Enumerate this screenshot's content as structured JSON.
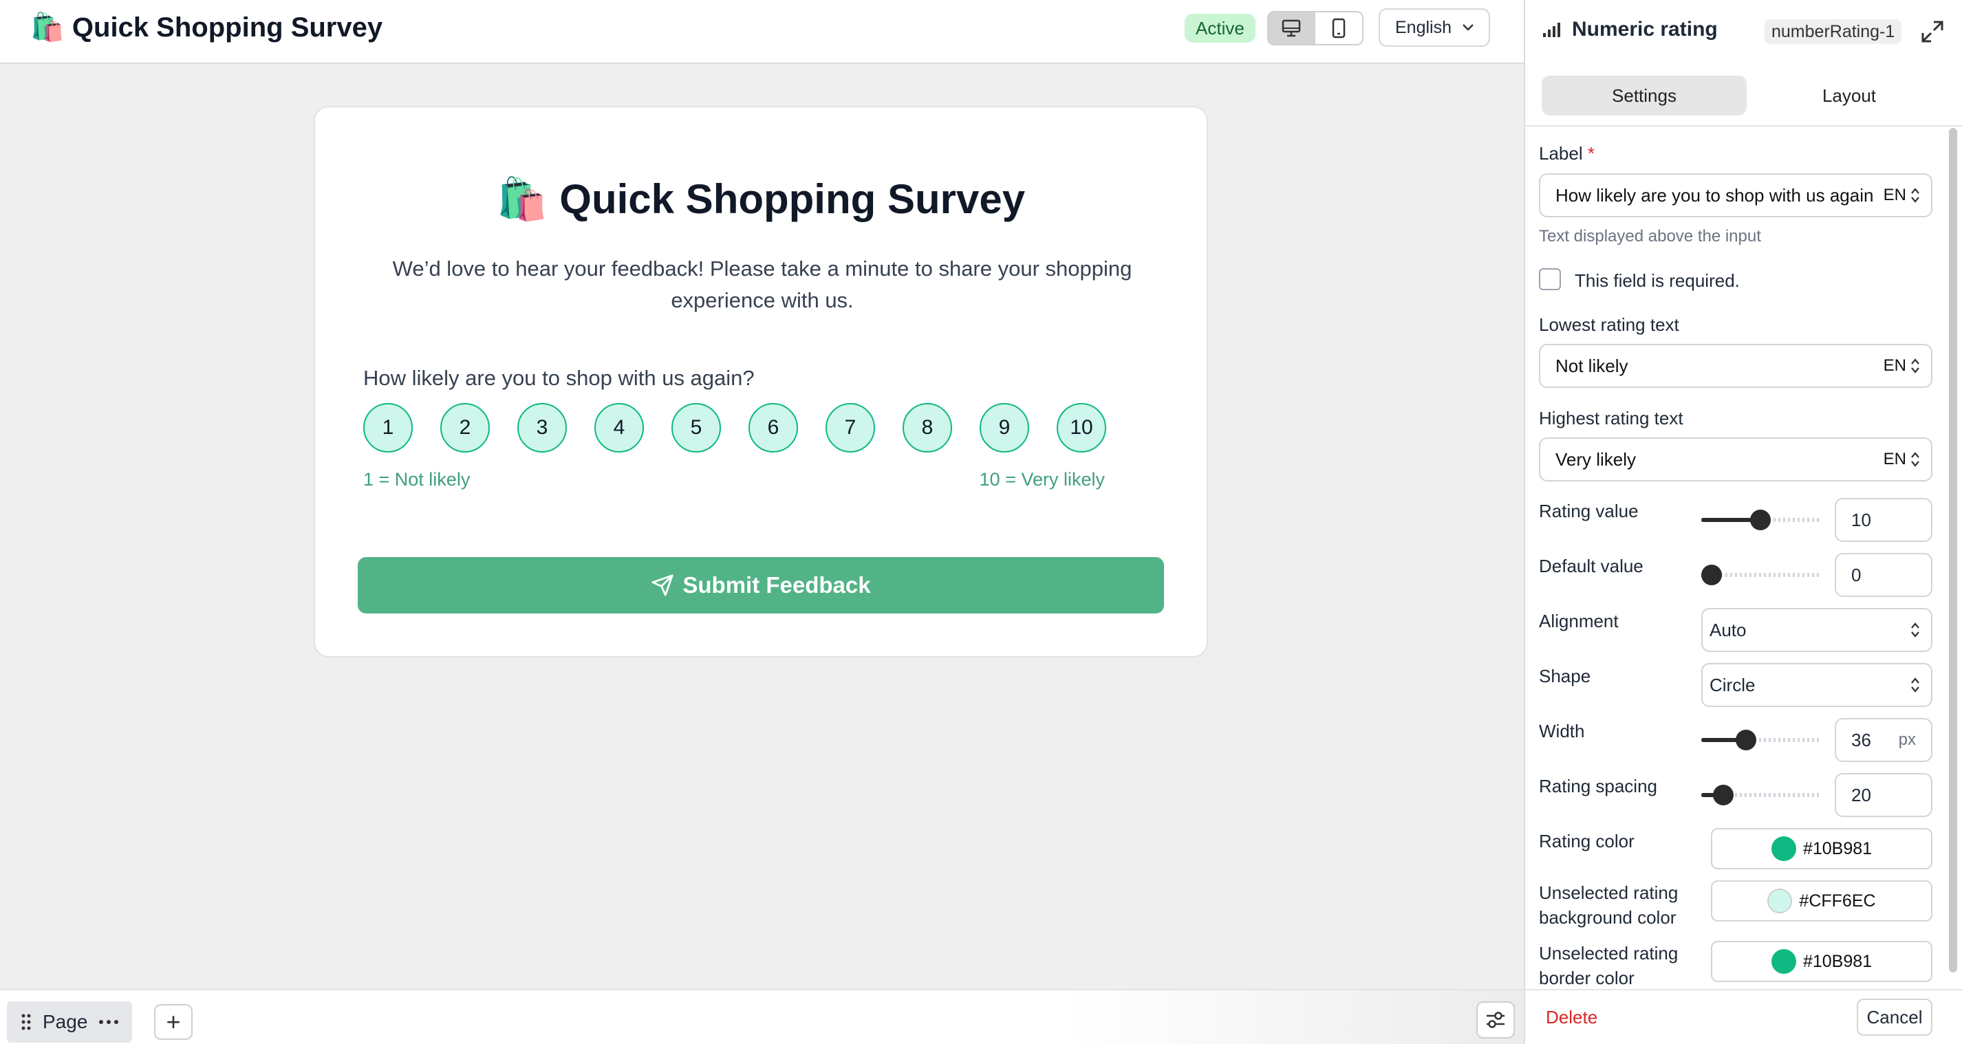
{
  "app": {
    "title": "🛍️ Quick Shopping Survey",
    "status": "Active",
    "language": "English",
    "device_icons": [
      "desktop-icon",
      "mobile-icon"
    ]
  },
  "survey": {
    "title": "🛍️ Quick Shopping Survey",
    "description": "We’d love to hear your feedback! Please take a minute to share your shopping experience with us.",
    "question": "How likely are you to shop with us again?",
    "ratings": [
      "1",
      "2",
      "3",
      "4",
      "5",
      "6",
      "7",
      "8",
      "9",
      "10"
    ],
    "low_text": "1 = Not likely",
    "high_text": "10 = Very likely",
    "submit_label": "Submit Feedback"
  },
  "bottom": {
    "page_label": "Page",
    "add_label": "+"
  },
  "panel": {
    "title": "Numeric rating",
    "element_id": "numberRating-1",
    "tabs": [
      "Settings",
      "Layout"
    ],
    "active_tab": "Settings",
    "label_label": "Label",
    "required_star": "*",
    "label_value": "How likely are you to shop with us again?",
    "lang_code": "EN",
    "label_help": "Text displayed above the input",
    "required_text": "This field is required.",
    "required_checked": false,
    "lowest_label": "Lowest rating text",
    "lowest_value": "Not likely",
    "highest_label": "Highest rating text",
    "highest_value": "Very likely",
    "rating_value_label": "Rating value",
    "rating_value": "10",
    "rating_value_level": 0.5,
    "default_value_label": "Default value",
    "default_value": "0",
    "default_value_level": 0.0,
    "alignment_label": "Alignment",
    "alignment_value": "Auto",
    "shape_label": "Shape",
    "shape_value": "Circle",
    "width_label": "Width",
    "width_value": "36",
    "width_unit": "px",
    "width_level": 0.35,
    "spacing_label": "Rating spacing",
    "spacing_value": "20",
    "spacing_level": 0.12,
    "rating_color_label": "Rating color",
    "rating_color": "#10B981",
    "unselected_bg_label_1": "Unselected rating",
    "unselected_bg_label_2": "background color",
    "unselected_bg_color": "#CFF6EC",
    "unselected_border_label_1": "Unselected rating",
    "unselected_border_label_2": "border color",
    "unselected_border_color": "#10B981",
    "delete_label": "Delete",
    "cancel_label": "Cancel"
  },
  "colors": {
    "accent": "#10B981",
    "submit_bg": "#52B386",
    "danger": "#DC2626"
  }
}
